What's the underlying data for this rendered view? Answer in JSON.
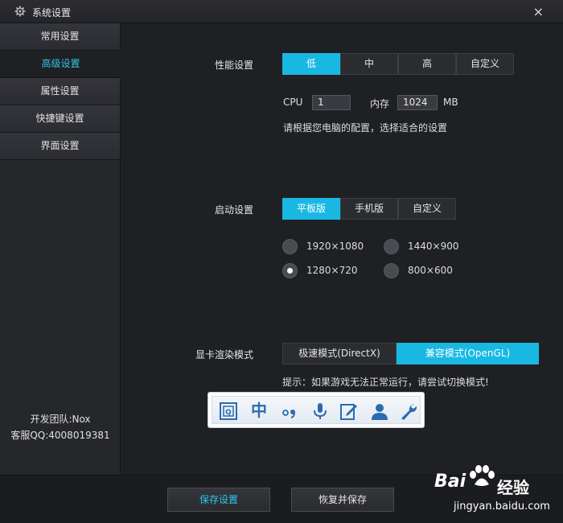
{
  "window": {
    "title": "系统设置",
    "close_glyph": "×"
  },
  "sidebar": {
    "items": [
      {
        "label": "常用设置",
        "active": false
      },
      {
        "label": "高级设置",
        "active": true
      },
      {
        "label": "属性设置",
        "active": false
      },
      {
        "label": "快捷键设置",
        "active": false
      },
      {
        "label": "界面设置",
        "active": false
      }
    ],
    "footer": {
      "team": "开发团队:Nox",
      "support": "客服QQ:4008019381"
    }
  },
  "performance": {
    "label": "性能设置",
    "options": [
      "低",
      "中",
      "高",
      "自定义"
    ],
    "selected": "低",
    "cpu_label": "CPU",
    "cpu_value": "1",
    "memory_label": "内存",
    "memory_value": "1024",
    "memory_unit": "MB",
    "hint": "请根据您电脑的配置，选择适合的设置"
  },
  "startup": {
    "label": "启动设置",
    "options": [
      "平板版",
      "手机版",
      "自定义"
    ],
    "selected": "平板版",
    "resolutions": [
      {
        "label": "1920×1080",
        "checked": false
      },
      {
        "label": "1440×900",
        "checked": false
      },
      {
        "label": "1280×720",
        "checked": true
      },
      {
        "label": "800×600",
        "checked": false
      }
    ]
  },
  "graphics": {
    "label": "显卡渲染模式",
    "options": [
      "极速模式(DirectX)",
      "兼容模式(OpenGL)"
    ],
    "selected": "兼容模式(OpenGL)",
    "hint": "提示：如果游戏无法正常运行，请尝试切换模式!"
  },
  "ime_toolbar": {
    "icons": [
      "ime-toggle-icon",
      "chinese-mode-icon",
      "punctuation-icon",
      "microphone-icon",
      "handwriting-icon",
      "user-icon",
      "wrench-icon"
    ],
    "chinese_glyph": "中"
  },
  "footer_buttons": {
    "save": "保存设置",
    "restore": "恢复并保存"
  },
  "watermark": {
    "brand": "Bai",
    "brand_suffix": "经验",
    "url": "jingyan.baidu.com"
  },
  "colors": {
    "accent": "#19b8e3",
    "background": "#1f2023",
    "sidebar": "#26272b"
  }
}
